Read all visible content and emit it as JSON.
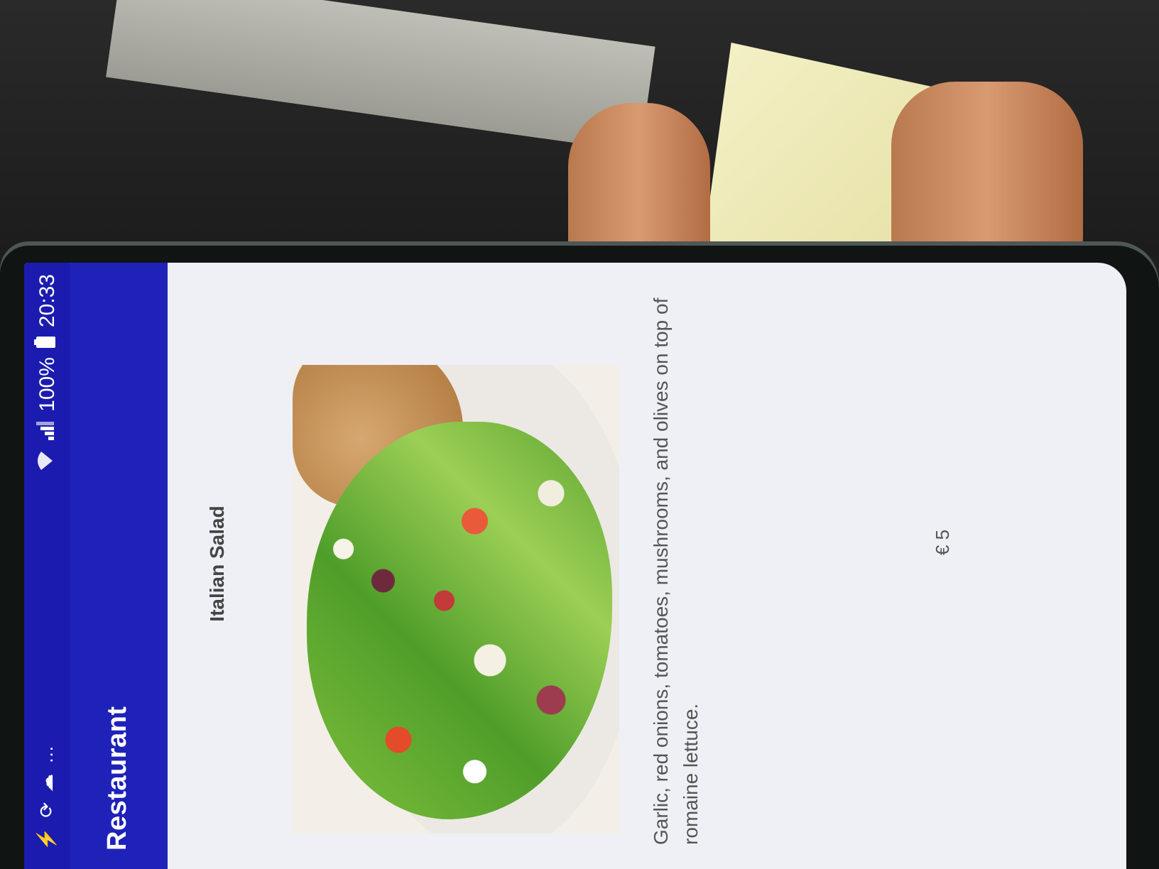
{
  "status_bar": {
    "left_icons": [
      "lightning-icon",
      "sync-icon",
      "cloud-icon",
      "more-dots-icon"
    ],
    "wifi_icon": "wifi-icon",
    "signal_icon": "signal-icon",
    "battery_percent": "100%",
    "battery_icon": "battery-icon",
    "time": "20:33"
  },
  "toolbar": {
    "title": "Restaurant"
  },
  "dish": {
    "name": "Italian Salad",
    "image_alt": "salad-photo",
    "description": "Garlic, red onions, tomatoes, mushrooms, and olives on top of romaine lettuce.",
    "price": "€ 5"
  },
  "colors": {
    "status_bar": "#1b1bb0",
    "toolbar": "#1e22b8",
    "screen_background": "#eef0f5"
  }
}
